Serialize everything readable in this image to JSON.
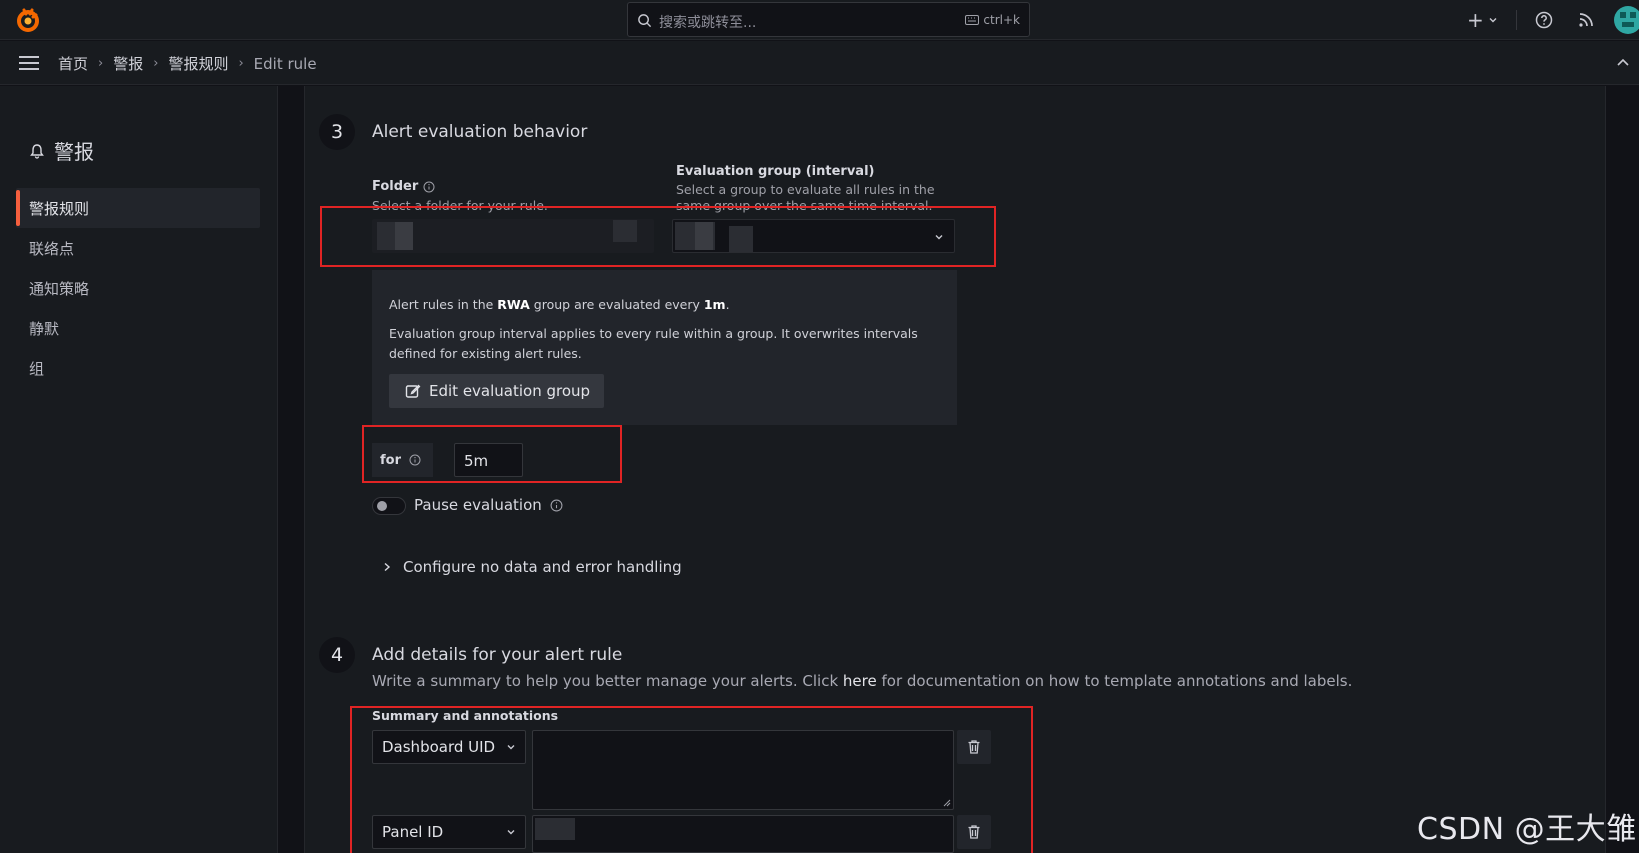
{
  "topbar": {
    "search_placeholder": "搜索或跳转至...",
    "search_shortcut": "ctrl+k"
  },
  "breadcrumb": {
    "items": [
      "首页",
      "警报",
      "警报规则"
    ],
    "current": "Edit rule"
  },
  "sidebar": {
    "title": "警报",
    "items": [
      {
        "label": "警报规则",
        "active": true
      },
      {
        "label": "联络点",
        "active": false
      },
      {
        "label": "通知策略",
        "active": false
      },
      {
        "label": "静默",
        "active": false
      },
      {
        "label": "组",
        "active": false
      }
    ]
  },
  "step3": {
    "number": "3",
    "title": "Alert evaluation behavior",
    "folder_label": "Folder",
    "folder_desc": "Select a folder for your rule.",
    "group_label": "Evaluation group (interval)",
    "group_desc_1": "Select a group to evaluate all rules in the",
    "group_desc_2": "same group over the same time interval.",
    "info_pre": "Alert rules in the ",
    "info_group": "RWA",
    "info_mid": " group are evaluated every ",
    "info_interval": "1m",
    "info_post": ".",
    "info_line2": "Evaluation group interval applies to every rule within a group. It overwrites intervals defined for existing alert rules.",
    "edit_button": "Edit evaluation group",
    "for_label": "for",
    "for_value": "5m",
    "pause_label": "Pause evaluation",
    "config_label": "Configure no data and error handling"
  },
  "step4": {
    "number": "4",
    "title": "Add details for your alert rule",
    "desc_pre": "Write a summary to help you better manage your alerts. Click ",
    "desc_link": "here",
    "desc_post": " for documentation on how to template annotations and labels.",
    "summary_label": "Summary and annotations",
    "annotations": [
      {
        "key": "Dashboard UID"
      },
      {
        "key": "Panel ID"
      }
    ]
  },
  "watermark": "CSDN @王大雏",
  "colors": {
    "accent": "#f55f3e",
    "highlight_box": "#e02424"
  }
}
